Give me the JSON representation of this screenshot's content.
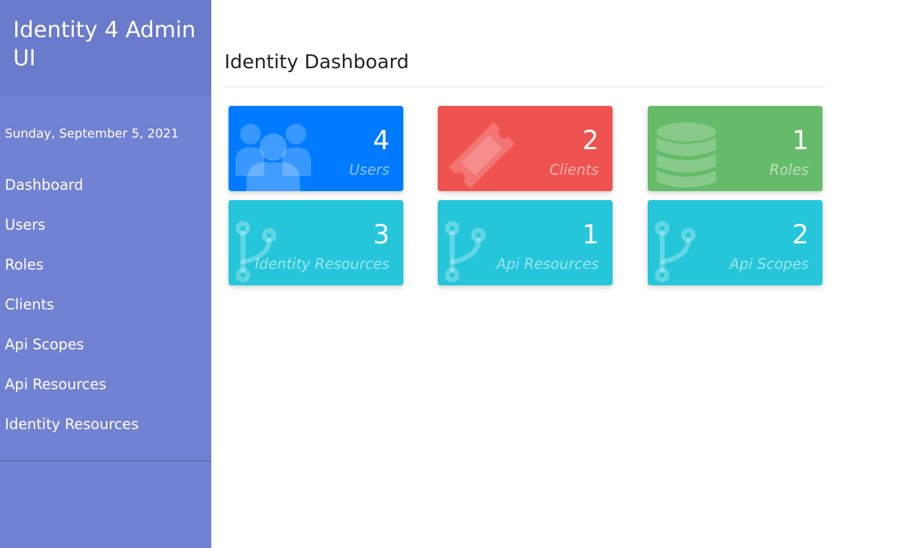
{
  "sidebar": {
    "brand_title": "Identity 4 Admin UI",
    "date": "Sunday, September 5, 2021",
    "nav": [
      "Dashboard",
      "Users",
      "Roles",
      "Clients",
      "Api Scopes",
      "Api Resources",
      "Identity Resources"
    ]
  },
  "main": {
    "title": "Identity Dashboard",
    "cards": [
      {
        "count": "4",
        "label": "Users",
        "icon": "users-icon",
        "color": "#007bff"
      },
      {
        "count": "2",
        "label": "Clients",
        "icon": "ticket-icon",
        "color": "#ef5350"
      },
      {
        "count": "1",
        "label": "Roles",
        "icon": "database-icon",
        "color": "#66bb6a"
      },
      {
        "count": "3",
        "label": "Identity Resources",
        "icon": "code-branch-icon",
        "color": "#26c6da"
      },
      {
        "count": "1",
        "label": "Api Resources",
        "icon": "code-branch-icon",
        "color": "#26c6da"
      },
      {
        "count": "2",
        "label": "Api Scopes",
        "icon": "code-branch-icon",
        "color": "#26c6da"
      }
    ]
  }
}
